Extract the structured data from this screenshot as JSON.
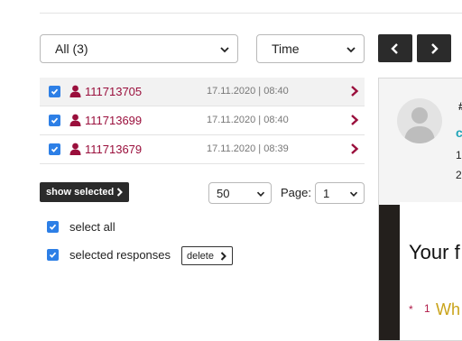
{
  "filters": {
    "response_filter": "All (3)",
    "sort_by": "Time"
  },
  "nav": {
    "prev_icon": "chevron-left-icon",
    "next_icon": "chevron-right-icon"
  },
  "responses": [
    {
      "id": "111713705",
      "datetime": "17.11.2020 | 08:40",
      "checked": true,
      "active": true
    },
    {
      "id": "111713699",
      "datetime": "17.11.2020 | 08:40",
      "checked": true,
      "active": false
    },
    {
      "id": "111713679",
      "datetime": "17.11.2020 | 08:39",
      "checked": true,
      "active": false
    }
  ],
  "controls": {
    "show_selected_label": "show selected",
    "per_page": "50",
    "page_label": "Page:",
    "page": "1"
  },
  "options": {
    "select_all_label": "select all",
    "selected_responses_label": "selected responses",
    "delete_label": "delete"
  },
  "detail": {
    "hash_text": "#",
    "c_text": "c",
    "line_one": "1",
    "line_two": "2.",
    "heading_partial": "Your f",
    "question_star": "*",
    "question_number": "1",
    "question_partial": "Wh"
  },
  "colors": {
    "accent_red": "#9a0f3c",
    "checkbox_blue": "#2d7fe6",
    "teal": "#1fa4b8",
    "gold": "#c9a319",
    "dark_button": "#2b2b2b"
  }
}
